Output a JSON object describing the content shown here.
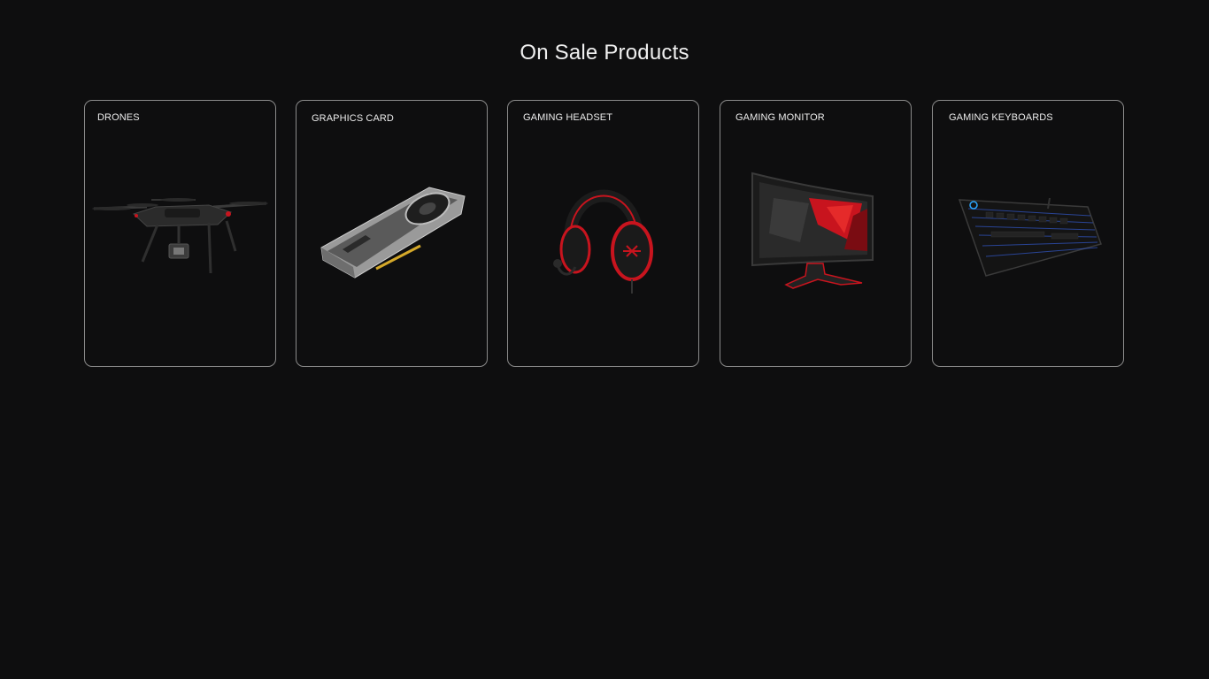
{
  "section": {
    "title": "On Sale Products"
  },
  "products": [
    {
      "label": "DRONES",
      "icon": "drone-icon"
    },
    {
      "label": "GRAPHICS CARD",
      "icon": "graphics-card-icon"
    },
    {
      "label": "GAMING HEADSET",
      "icon": "headset-icon"
    },
    {
      "label": "GAMING MONITOR",
      "icon": "monitor-icon"
    },
    {
      "label": "GAMING KEYBOARDS",
      "icon": "keyboard-icon"
    }
  ],
  "colors": {
    "background": "#0e0e0f",
    "card_border": "#8a8a8a",
    "accent_red": "#c8141e",
    "keyboard_glow": "#3b6cff"
  }
}
